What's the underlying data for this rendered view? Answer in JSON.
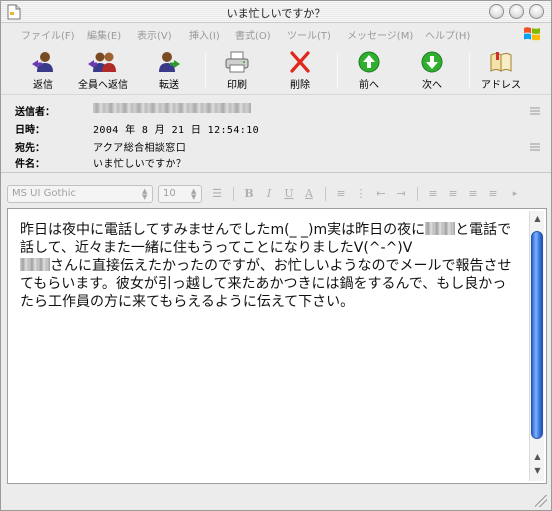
{
  "window": {
    "title": "いま忙しいですか？"
  },
  "menu": {
    "items": [
      "ファイル(F)",
      "編集(E)",
      "表示(V)",
      "挿入(I)",
      "書式(O)",
      "ツール(T)",
      "メッセージ(M)",
      "ヘルプ(H)"
    ]
  },
  "toolbar": {
    "reply": "返信",
    "reply_all": "全員へ返信",
    "forward": "転送",
    "print": "印刷",
    "delete": "削除",
    "previous": "前へ",
    "next": "次へ",
    "address": "アドレス"
  },
  "headers": {
    "from_label": "送信者：",
    "date_label": "日時：",
    "date_value": "2004 年 8 月 21 日 12:54:10",
    "to_label": "宛先：",
    "to_value": "アクア総合相談窓口",
    "subject_label": "件名：",
    "subject_value": "いま忙しいですか？"
  },
  "format": {
    "font": "MS UI Gothic",
    "size": "10"
  },
  "message": {
    "part1": "昨日は夜中に電話してすみませんでしたm(_ _)m実は昨日の夜に",
    "part2": "と電話で話して、近々また一緒に住もうってことになりましたV(^-^)V",
    "part3": "さんに直接伝えたかったのですが、お忙しいようなのでメールで報告させてもらいます。彼女が引っ越して来たあかつきには鍋をするんで、もし良かったら工作員の方に来てもらえるように伝えて下さい。"
  },
  "colors": {
    "scroll_thumb": "#3d7ae0",
    "arrow_green": "#2fae2f",
    "delete_red": "#e0281c"
  }
}
